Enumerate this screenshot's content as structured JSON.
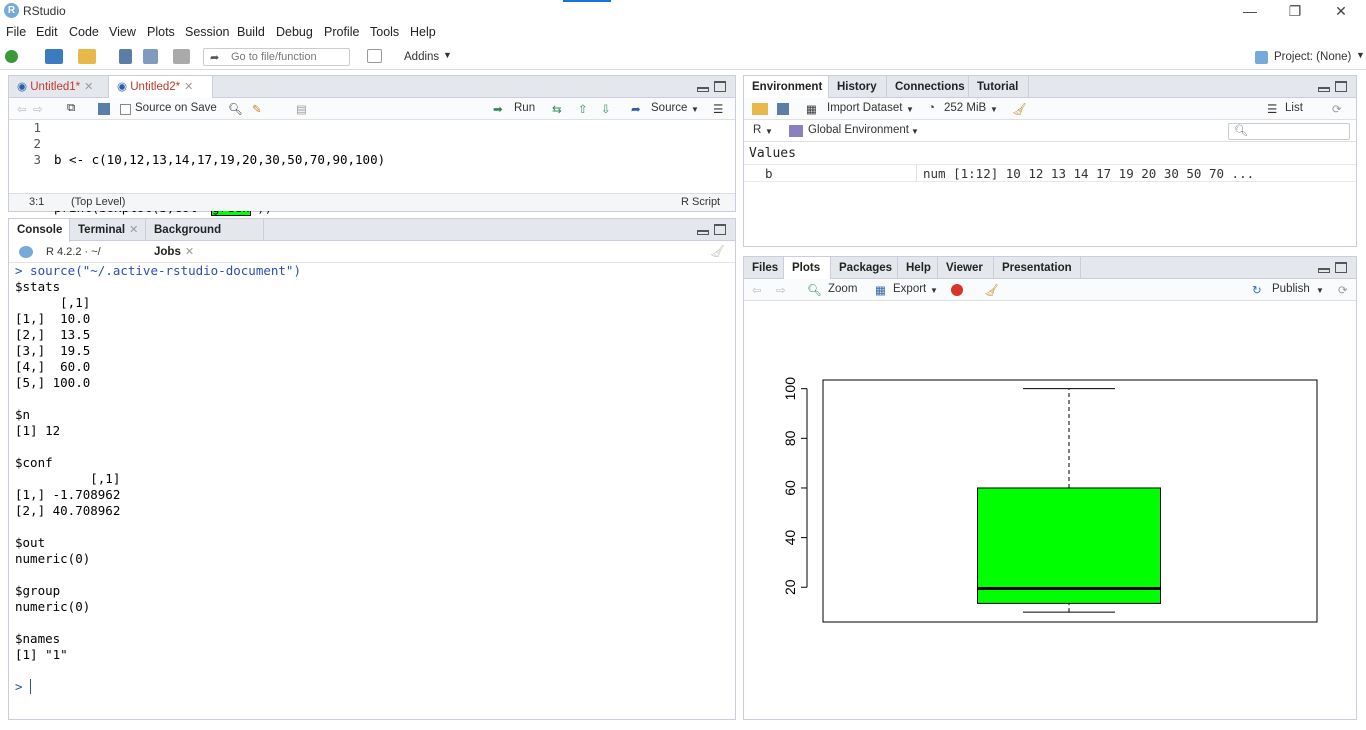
{
  "app": {
    "title": "RStudio",
    "logo_letter": "R",
    "win_min": "—",
    "win_restore": "❐",
    "win_close": "✕"
  },
  "menu": [
    "File",
    "Edit",
    "Code",
    "View",
    "Plots",
    "Session",
    "Build",
    "Debug",
    "Profile",
    "Tools",
    "Help"
  ],
  "toolbar": {
    "goto_placeholder": "Go to file/function",
    "addins": "Addins",
    "project": "Project: (None)"
  },
  "source": {
    "tabs": [
      "Untitled1*",
      "Untitled2*"
    ],
    "source_on_save": "Source on Save",
    "run": "Run",
    "source_btn": "Source",
    "lines": [
      "1",
      "2",
      "3"
    ],
    "code": {
      "l1": "b <- c(10,12,13,14,17,19,20,30,50,70,90,100)",
      "l2a": "print(boxplot(b,col=\"",
      "l2b": "green",
      "l2c": "\"))"
    },
    "status_pos": "3:1",
    "status_level": "(Top Level)",
    "status_type": "R Script"
  },
  "console": {
    "tabs": [
      "Console",
      "Terminal",
      "Background Jobs"
    ],
    "version": "R 4.2.2 · ~/",
    "lines": [
      "> source(\"~/.active-rstudio-document\")",
      "$stats",
      "      [,1]",
      "[1,]  10.0",
      "[2,]  13.5",
      "[3,]  19.5",
      "[4,]  60.0",
      "[5,] 100.0",
      "",
      "$n",
      "[1] 12",
      "",
      "$conf",
      "          [,1]",
      "[1,] -1.708962",
      "[2,] 40.708962",
      "",
      "$out",
      "numeric(0)",
      "",
      "$group",
      "numeric(0)",
      "",
      "$names",
      "[1] \"1\"",
      "",
      "> "
    ]
  },
  "env": {
    "tabs": [
      "Environment",
      "History",
      "Connections",
      "Tutorial"
    ],
    "import": "Import Dataset",
    "mem": "252 MiB",
    "list": "List",
    "lang": "R",
    "scope": "Global Environment",
    "section": "Values",
    "rows": [
      {
        "name": "b",
        "value": "num [1:12] 10 12 13 14 17 19 20 30 50 70 ..."
      }
    ]
  },
  "files": {
    "tabs": [
      "Files",
      "Plots",
      "Packages",
      "Help",
      "Viewer",
      "Presentation"
    ],
    "zoom": "Zoom",
    "export": "Export",
    "publish": "Publish"
  },
  "chart_data": {
    "type": "boxplot",
    "values": [
      10,
      12,
      13,
      14,
      17,
      19,
      20,
      30,
      50,
      70,
      90,
      100
    ],
    "stats": {
      "min": 10,
      "q1": 13.5,
      "median": 19.5,
      "q3": 60,
      "max": 100
    },
    "fill": "#00ff00",
    "yticks": [
      "20",
      "40",
      "60",
      "80",
      "100"
    ],
    "ylim": [
      6,
      103.5
    ]
  }
}
